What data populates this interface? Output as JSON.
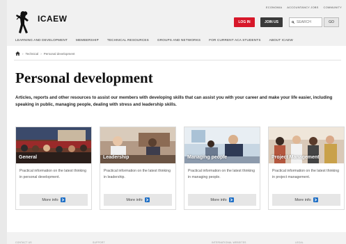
{
  "header": {
    "top_links": [
      "ECONOMIA",
      "ACCOUNTANCY JOBS",
      "COMMUNITY"
    ],
    "logo_text": "ICAEW",
    "login_label": "LOG IN",
    "join_label": "JOIN US",
    "search_placeholder": "SEARCH",
    "go_label": "GO",
    "nav": [
      "LEARNING AND DEVELOPMENT",
      "MEMBERSHIP",
      "TECHNICAL RESOURCES",
      "GROUPS AND NETWORKS",
      "FOR CURRENT ACA STUDENTS",
      "ABOUT ICAEW"
    ]
  },
  "breadcrumb": [
    "Technical",
    "Personal development"
  ],
  "page": {
    "title": "Personal development",
    "intro": "Articles, reports and other resources to assist our members with developing skills that can assist you with your career and make your life easier, including speaking in public, managing people, dealing with stress and leadership skills."
  },
  "cards": [
    {
      "title": "General",
      "text": "Practical information on the latest thinking in personal development.",
      "button": "More info"
    },
    {
      "title": "Leadership",
      "text": "Practical information on the latest thinking in leadership.",
      "button": "More info"
    },
    {
      "title": "Managing people",
      "text": "Practical information on the latest thinking in managing people.",
      "button": "More info"
    },
    {
      "title": "Project Management",
      "text": "Practical information on the latest thinking in project management.",
      "button": "More info"
    }
  ],
  "footer": {
    "columns": [
      "CONTACT US",
      "SUPPORT",
      "INTERNATIONAL WEBSITES",
      "LEGAL"
    ]
  },
  "colors": {
    "login_red": "#d7182a",
    "join_dark": "#3a3a3a",
    "info_blue": "#1f6fc5"
  }
}
